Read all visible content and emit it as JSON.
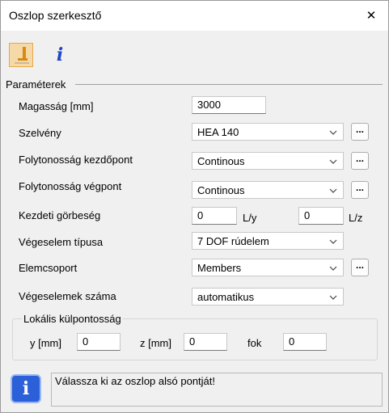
{
  "window": {
    "title": "Oszlop szerkesztő",
    "close_glyph": "✕"
  },
  "toolbar": {
    "column_icon": "column-icon",
    "info_glyph": "i"
  },
  "parameters": {
    "group_label": "Paraméterek",
    "height": {
      "label": "Magasság [mm]",
      "value": "3000"
    },
    "section": {
      "label": "Szelvény",
      "value": "HEA 140"
    },
    "continuity_start": {
      "label": "Folytonosság kezdőpont",
      "value": "Continous"
    },
    "continuity_end": {
      "label": "Folytonosság végpont",
      "value": "Continous"
    },
    "initial_curvature": {
      "label": "Kezdeti görbeség",
      "value1": "0",
      "unit1": "L/y",
      "value2": "0",
      "unit2": "L/z"
    },
    "fe_type": {
      "label": "Végeselem típusa",
      "value": "7 DOF rúdelem"
    },
    "element_group": {
      "label": "Elemcsoport",
      "value": "Members"
    },
    "fe_count": {
      "label": "Végeselemek száma",
      "value": "automatikus"
    },
    "dots_label": "..."
  },
  "eccentricity": {
    "title": "Lokális külpontosság",
    "y_label": "y [mm]",
    "y_value": "0",
    "z_label": "z [mm]",
    "z_value": "0",
    "deg_label": "fok",
    "deg_value": "0"
  },
  "status": {
    "icon_glyph": "i",
    "message": "Válassza ki az oszlop alsó pontját!"
  }
}
